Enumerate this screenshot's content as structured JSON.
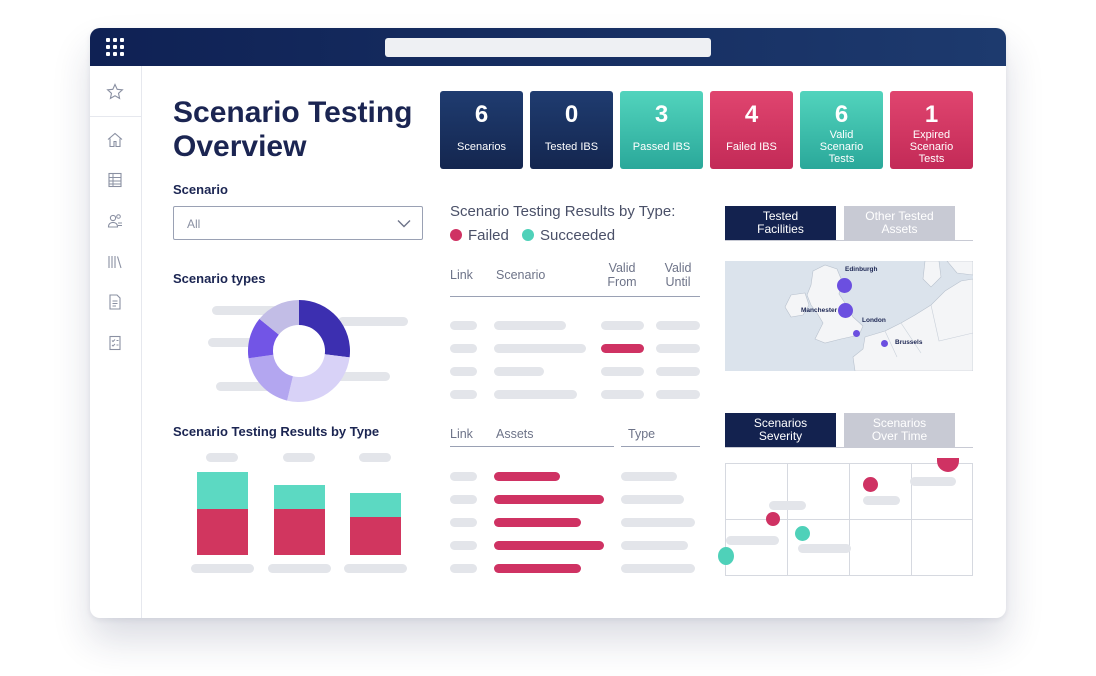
{
  "page_title_line1": "Scenario Testing",
  "page_title_line2": "Overview",
  "kpis": [
    {
      "value": "6",
      "label": "Scenarios",
      "color": "#1e3a6d"
    },
    {
      "value": "0",
      "label": "Tested IBS",
      "color": "#1e3a6d"
    },
    {
      "value": "3",
      "label": "Passed IBS",
      "color": "#44c8b0"
    },
    {
      "value": "4",
      "label": "Failed IBS",
      "color": "#d1365f"
    },
    {
      "value": "6",
      "label": "Valid Scenario Tests",
      "color": "#44c8b0"
    },
    {
      "value": "1",
      "label": "Expired Scenario Tests",
      "color": "#d1365f"
    }
  ],
  "filter": {
    "label": "Scenario",
    "value": "All"
  },
  "scenario_types": {
    "title": "Scenario types"
  },
  "bar_section": {
    "title": "Scenario Testing Results by Type"
  },
  "results_panel": {
    "title": "Scenario Testing Results by Type:",
    "legend": [
      {
        "name": "Failed",
        "color": "#cf3263"
      },
      {
        "name": "Succeeded",
        "color": "#4fd1b9"
      }
    ]
  },
  "table1": {
    "columns": [
      "Link",
      "Scenario",
      "Valid From",
      "Valid Until"
    ]
  },
  "table2": {
    "columns": [
      "Link",
      "Assets",
      "Type"
    ]
  },
  "map_tabs": {
    "active": "Tested Facilities",
    "inactive": "Other Tested Assets"
  },
  "map": {
    "cities": [
      "Edinburgh",
      "Manchester",
      "London",
      "Brussels"
    ]
  },
  "severity_tabs": {
    "active": "Scenarios Severity",
    "inactive": "Scenarios Over Time"
  },
  "colors": {
    "navy": "#13224f",
    "teal": "#4fd1b9",
    "red": "#cf3263",
    "purple": "#3f2fb0"
  },
  "icons": [
    "apps-grid-icon",
    "star-icon",
    "home-icon",
    "table-icon",
    "users-icon",
    "library-icon",
    "document-icon",
    "checklist-icon",
    "chevron-down-icon"
  ]
}
